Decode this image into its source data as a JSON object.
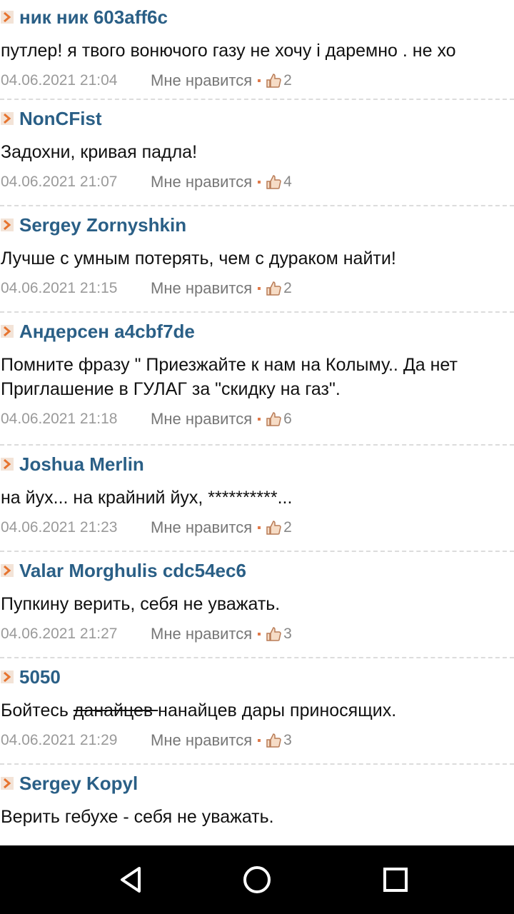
{
  "comments": [
    {
      "author": "ник ник 603aff6c",
      "lines": [
        "путлер! я твого вонючого газу не хочу і даремно . не хо"
      ],
      "date": "04.06.2021 21:04",
      "like_label": "Мне нравится",
      "likes": "2"
    },
    {
      "author": "NonCFist",
      "lines": [
        "Задохни, кривая падла!"
      ],
      "date": "04.06.2021 21:07",
      "like_label": "Мне нравится",
      "likes": "4"
    },
    {
      "author": "Sergey Zornyshkin",
      "lines": [
        "Лучше с умным потерять, чем с дураком найти!"
      ],
      "date": "04.06.2021 21:15",
      "like_label": "Мне нравится",
      "likes": "2"
    },
    {
      "author": "Андерсен a4cbf7de",
      "lines": [
        "Помните фразу \" Приезжайте к нам на Колыму.. Да нет",
        "Приглашение в ГУЛАГ за \"скидку на газ\"."
      ],
      "date": "04.06.2021 21:18",
      "like_label": "Мне нравится",
      "likes": "6"
    },
    {
      "author": "Joshua Merlin",
      "lines": [
        "на йух... на крайний йух, **********..."
      ],
      "date": "04.06.2021 21:23",
      "like_label": "Мне нравится",
      "likes": "2"
    },
    {
      "author": "Valar Morghulis cdc54ec6",
      "lines": [
        "Пупкину верить, себя не уважать."
      ],
      "date": "04.06.2021 21:27",
      "like_label": "Мне нравится",
      "likes": "3"
    },
    {
      "author": "5050",
      "text_parts": {
        "before": "Бойтесь ",
        "struck": "данайцев ",
        "after": "нанайцев дары приносящих."
      },
      "date": "04.06.2021 21:29",
      "like_label": "Мне нравится",
      "likes": "3"
    },
    {
      "author": "Sergey Kopyl",
      "lines": [
        "Верить гебухе - себя не уважать."
      ]
    }
  ],
  "colors": {
    "author": "#2a5f86",
    "arrow_bg": "#e6732e",
    "separator": "#dcdcdc",
    "navbar": "#000000"
  },
  "icons": {
    "author_marker": "arrow-icon",
    "like": "thumbs-up-icon",
    "nav_back": "back-icon",
    "nav_home": "home-icon",
    "nav_recents": "recents-icon"
  }
}
